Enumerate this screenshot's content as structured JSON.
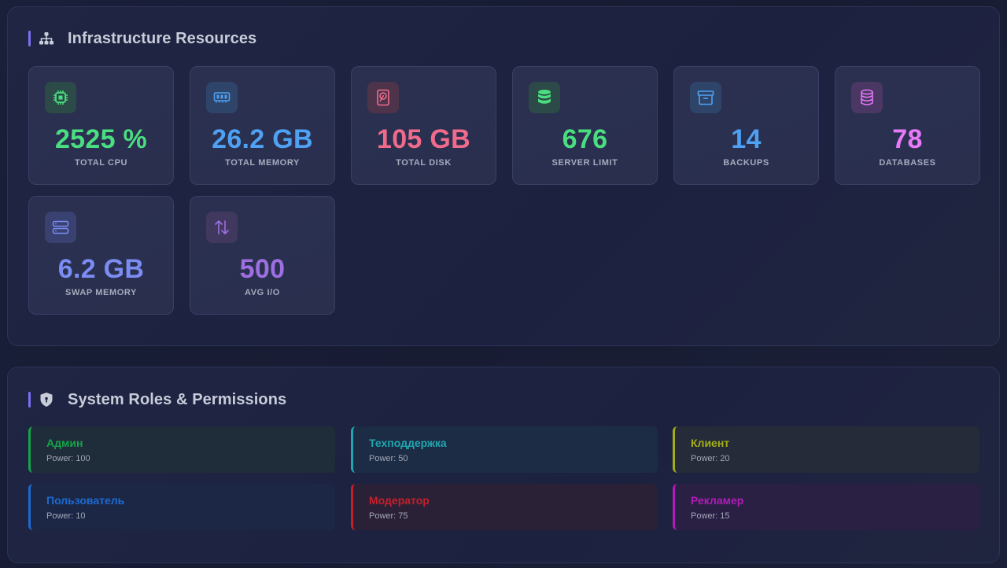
{
  "infrastructure": {
    "title": "Infrastructure Resources",
    "header_icon": "sitemap-icon",
    "cards": [
      {
        "value": "2525 %",
        "label": "TOTAL CPU",
        "icon": "cpu-icon",
        "color": "#4ade80",
        "icon_bg": "#2c4a47"
      },
      {
        "value": "26.2 GB",
        "label": "TOTAL MEMORY",
        "icon": "memory-icon",
        "color": "#4ea1f3",
        "icon_bg": "#2f4469"
      },
      {
        "value": "105 GB",
        "label": "TOTAL DISK",
        "icon": "hard-drive-icon",
        "color": "#f06b8b",
        "icon_bg": "#4d344b"
      },
      {
        "value": "676",
        "label": "SERVER LIMIT",
        "icon": "database-stack-icon",
        "color": "#4ade80",
        "icon_bg": "#2c4a47"
      },
      {
        "value": "14",
        "label": "BACKUPS",
        "icon": "archive-icon",
        "color": "#4ea1f3",
        "icon_bg": "#2f4469"
      },
      {
        "value": "78",
        "label": "DATABASES",
        "icon": "database-icon",
        "color": "#e879f9",
        "icon_bg": "#4b3764"
      },
      {
        "value": "6.2 GB",
        "label": "SWAP MEMORY",
        "icon": "server-icon",
        "color": "#7b8cf2",
        "icon_bg": "#394170"
      },
      {
        "value": "500",
        "label": "AVG I/O",
        "icon": "arrows-up-down-icon",
        "color": "#9d6fe0",
        "icon_bg": "#40385f"
      }
    ]
  },
  "roles": {
    "title": "System Roles & Permissions",
    "header_icon": "shield-icon",
    "items": [
      {
        "name": "Админ",
        "power": "Power: 100",
        "color": "#16a34a",
        "bg": "#1f2c3a"
      },
      {
        "name": "Техподдержка",
        "power": "Power: 50",
        "color": "#1fa7b1",
        "bg": "#1d2c45"
      },
      {
        "name": "Клиент",
        "power": "Power: 20",
        "color": "#a3b012",
        "bg": "#262b3a"
      },
      {
        "name": "Пользователь",
        "power": "Power: 10",
        "color": "#1d6ad1",
        "bg": "#1c2746"
      },
      {
        "name": "Модератор",
        "power": "Power: 75",
        "color": "#c71f2a",
        "bg": "#2b2137"
      },
      {
        "name": "Рекламер",
        "power": "Power: 15",
        "color": "#b21bb8",
        "bg": "#2a2044"
      }
    ]
  }
}
